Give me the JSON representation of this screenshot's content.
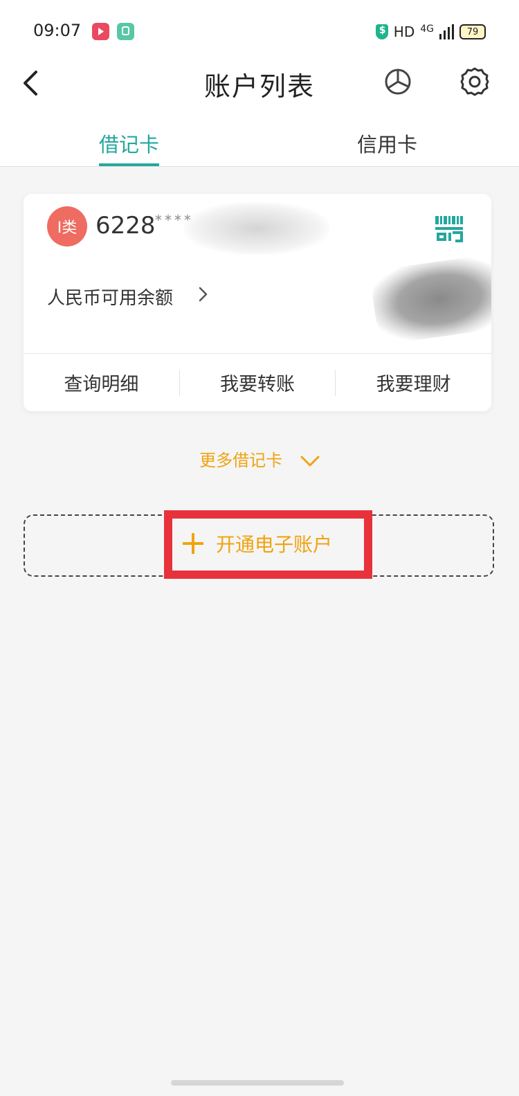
{
  "status_bar": {
    "time": "09:07",
    "signal_text": "HD",
    "network": "4G",
    "battery": "79"
  },
  "header": {
    "title": "账户列表",
    "icons": [
      "back-icon",
      "pie-chart-icon",
      "gear-icon"
    ]
  },
  "tabs": [
    {
      "label": "借记卡",
      "active": true
    },
    {
      "label": "信用卡",
      "active": false
    }
  ],
  "card": {
    "badge": "I类",
    "number_prefix": "6228",
    "number_mask": "****",
    "balance_label": "人民币可用余额",
    "actions": [
      "查询明细",
      "我要转账",
      "我要理财"
    ]
  },
  "more_cards_label": "更多借记卡",
  "open_account_label": "开通电子账户",
  "colors": {
    "accent": "#23a79e",
    "orange": "#f0a310",
    "badge": "#ee6c61",
    "highlight": "#e8323b"
  }
}
